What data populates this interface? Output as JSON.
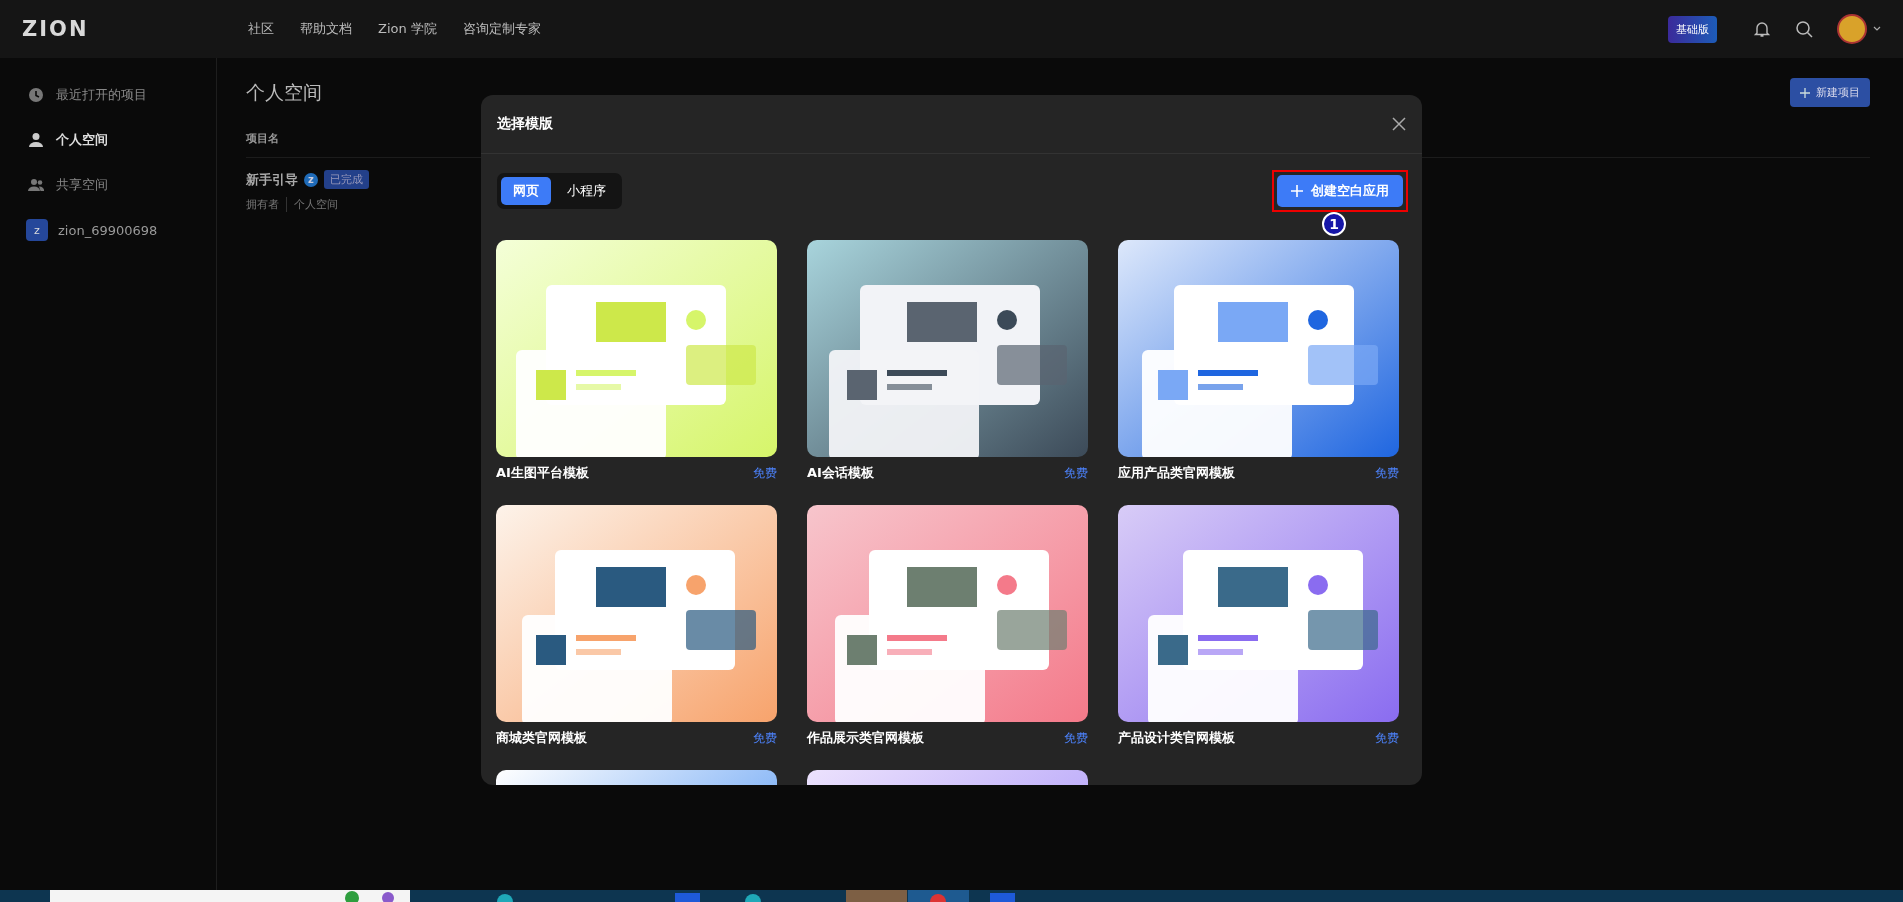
{
  "topbar": {
    "logo": "ZION",
    "nav": [
      "社区",
      "帮助文档",
      "Zion 学院",
      "咨询定制专家"
    ],
    "plan_badge": "基础版"
  },
  "sidebar": {
    "items": [
      {
        "label": "最近打开的项目",
        "selected": false
      },
      {
        "label": "个人空间",
        "selected": true
      },
      {
        "label": "共享空间",
        "selected": false
      }
    ],
    "workspace": {
      "initial": "z",
      "name": "zion_69900698"
    }
  },
  "main": {
    "title": "个人空间",
    "new_button": "新建项目",
    "columns": [
      "项目名"
    ],
    "projects": [
      {
        "name": "新手引导",
        "badge": "z",
        "status": "已完成",
        "owner_label": "拥有者",
        "space": "个人空间"
      }
    ]
  },
  "modal": {
    "title": "选择模版",
    "tabs": [
      {
        "label": "网页",
        "selected": true
      },
      {
        "label": "小程序",
        "selected": false
      }
    ],
    "create_button": "创建空白应用",
    "step_marker": "1",
    "templates": [
      {
        "kind": "template",
        "name": "AI生图平台模板",
        "price": "免费"
      },
      {
        "kind": "template",
        "name": "AI会话模板",
        "price": "免费"
      },
      {
        "kind": "template",
        "name": "应用产品类官网模板",
        "price": "免费"
      },
      {
        "kind": "template",
        "name": "商城类官网模板",
        "price": "免费"
      },
      {
        "kind": "template",
        "name": "作品展示类官网模板",
        "price": "免费"
      },
      {
        "kind": "template",
        "name": "产品设计类官网模板",
        "price": "免费"
      },
      {
        "kind": "picture"
      },
      {
        "kind": "picture"
      }
    ]
  }
}
